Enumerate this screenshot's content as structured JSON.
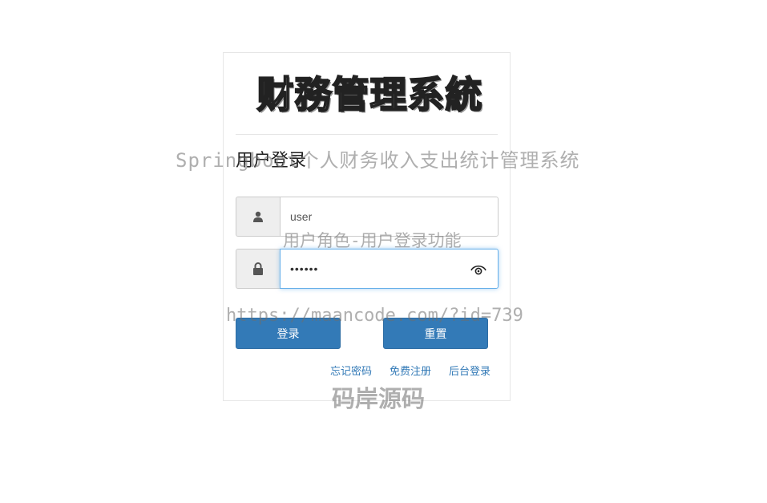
{
  "logo": {
    "text": "财務管理系統"
  },
  "form": {
    "title": "用户登录",
    "username": {
      "value": "user",
      "icon": "user-icon"
    },
    "password": {
      "value": "••••••",
      "icon": "lock-icon",
      "toggle_icon": "eye-icon"
    }
  },
  "buttons": {
    "login": "登录",
    "reset": "重置"
  },
  "links": {
    "forgot": "忘记密码",
    "register": "免费注册",
    "admin_login": "后台登录"
  },
  "watermarks": {
    "line1": "Springboot个人财务收入支出统计管理系统",
    "line2": "用户角色-用户登录功能",
    "line3": "https://maancode.com/?id=739",
    "line4": "码岸源码"
  },
  "colors": {
    "primary": "#337ab7",
    "link": "#337ab7",
    "focus_border": "#66afe9"
  }
}
